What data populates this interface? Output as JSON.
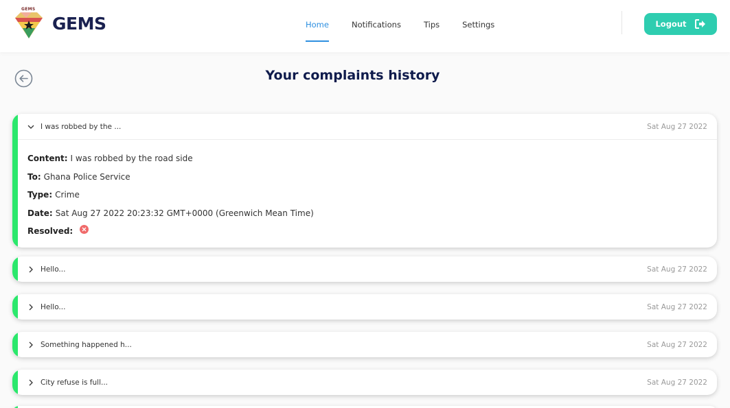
{
  "header": {
    "brand": "GEMS",
    "logo_text": "GEMS",
    "nav": [
      {
        "label": "Home",
        "active": true
      },
      {
        "label": "Notifications",
        "active": false
      },
      {
        "label": "Tips",
        "active": false
      },
      {
        "label": "Settings",
        "active": false
      }
    ],
    "logout_label": "Logout",
    "logout_icon": "sign-out-icon"
  },
  "page": {
    "title": "Your complaints history",
    "back_icon": "arrow-left-circle-icon"
  },
  "complaints": [
    {
      "subject": "I was robbed by the ...",
      "date": "Sat Aug 27 2022",
      "expanded": true,
      "details": {
        "content_label": "Content:",
        "content": "I was robbed by the road side",
        "to_label": "To:",
        "to": "Ghana Police Service",
        "type_label": "Type:",
        "type": "Crime",
        "date_label": "Date:",
        "date_full": "Sat Aug 27 2022 20:23:32 GMT+0000 (Greenwich Mean Time)",
        "resolved_label": "Resolved:",
        "resolved": false
      }
    },
    {
      "subject": "Hello...",
      "date": "Sat Aug 27 2022",
      "expanded": false
    },
    {
      "subject": "Hello...",
      "date": "Sat Aug 27 2022",
      "expanded": false
    },
    {
      "subject": "Something happened h...",
      "date": "Sat Aug 27 2022",
      "expanded": false
    },
    {
      "subject": "City refuse is full...",
      "date": "Sat Aug 27 2022",
      "expanded": false
    }
  ],
  "colors": {
    "accent": "#2d8fe0",
    "logout_bg": "#2ecdb0",
    "card_stripe": "#2be86c",
    "title": "#0f1b4c",
    "unresolved": "#f06a6a"
  }
}
